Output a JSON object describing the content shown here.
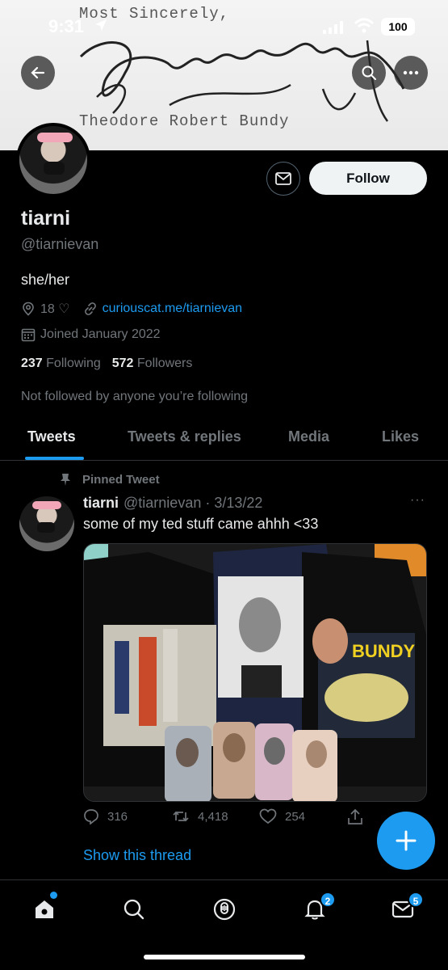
{
  "status_bar": {
    "time": "9:31",
    "battery": "100"
  },
  "banner": {
    "typed_top": "Most Sincerely,",
    "typed_bottom": "Theodore Robert Bundy"
  },
  "header": {
    "follow_label": "Follow"
  },
  "profile": {
    "name": "tiarni",
    "handle": "@tiarnievan",
    "bio": "she/her",
    "location": "18 ♡",
    "link": "curiouscat.me/tiarnievan",
    "joined": "Joined January 2022",
    "following_count": "237",
    "following_label": "Following",
    "followers_count": "572",
    "followers_label": "Followers",
    "not_followed": "Not followed by anyone you’re following"
  },
  "tabs": [
    {
      "label": "Tweets",
      "active": true
    },
    {
      "label": "Tweets & replies",
      "active": false
    },
    {
      "label": "Media",
      "active": false
    },
    {
      "label": "Likes",
      "active": false
    }
  ],
  "tweet": {
    "pinned_label": "Pinned Tweet",
    "name": "tiarni",
    "handle_date": "@tiarnievan · 3/13/22",
    "more": "···",
    "text": "some of my ted stuff came ahhh <33",
    "replies": "316",
    "retweets": "4,418",
    "likes": "254",
    "show_thread": "Show this thread"
  },
  "media_text": {
    "bundy": "BUNDY"
  },
  "bottom_nav": {
    "notifications_badge": "2",
    "messages_badge": "5"
  },
  "colors": {
    "accent": "#1d9bf0",
    "background": "#000000",
    "muted": "#71767b",
    "text": "#e7e9ea"
  }
}
